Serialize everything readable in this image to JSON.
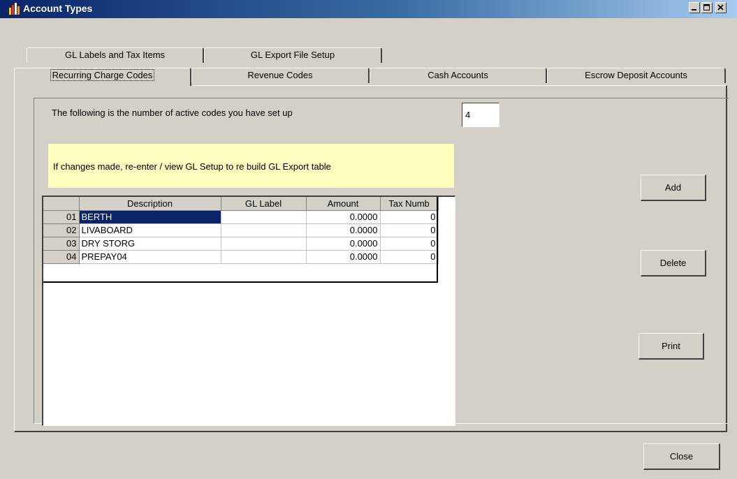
{
  "window": {
    "title": "Account Types",
    "minimize_icon": "minimize-icon",
    "maximize_icon": "maximize-icon",
    "close_icon": "close-icon"
  },
  "tabs": {
    "row_back": [
      {
        "label": "GL Labels and Tax Items"
      },
      {
        "label": "GL Export File Setup"
      }
    ],
    "row_front": [
      {
        "label": "Recurring Charge Codes",
        "active": true
      },
      {
        "label": "Revenue Codes"
      },
      {
        "label": "Cash Accounts"
      },
      {
        "label": "Escrow Deposit Accounts"
      }
    ]
  },
  "main": {
    "count_label": "The following is the number of active codes you have set up",
    "count_value": "4",
    "notice": "If changes made, re-enter / view GL Setup to re build GL Export table"
  },
  "grid": {
    "columns": [
      "Description",
      "GL Label",
      "Amount",
      "Tax Numb"
    ],
    "rows": [
      {
        "num": "01",
        "description": "BERTH",
        "gl_label": "",
        "amount": "0.0000",
        "tax": "0"
      },
      {
        "num": "02",
        "description": "LIVABOARD",
        "gl_label": "",
        "amount": "0.0000",
        "tax": "0"
      },
      {
        "num": "03",
        "description": "DRY STORG",
        "gl_label": "",
        "amount": "0.0000",
        "tax": "0"
      },
      {
        "num": "04",
        "description": "PREPAY04",
        "gl_label": "",
        "amount": "0.0000",
        "tax": "0"
      }
    ]
  },
  "buttons": {
    "add": "Add",
    "delete": "Delete",
    "print": "Print",
    "close": "Close"
  },
  "colors": {
    "title_bar": "#0a246a",
    "window_bg": "#d4d0c8",
    "notice_bg": "#ffffc0",
    "selection": "#0a246a"
  }
}
